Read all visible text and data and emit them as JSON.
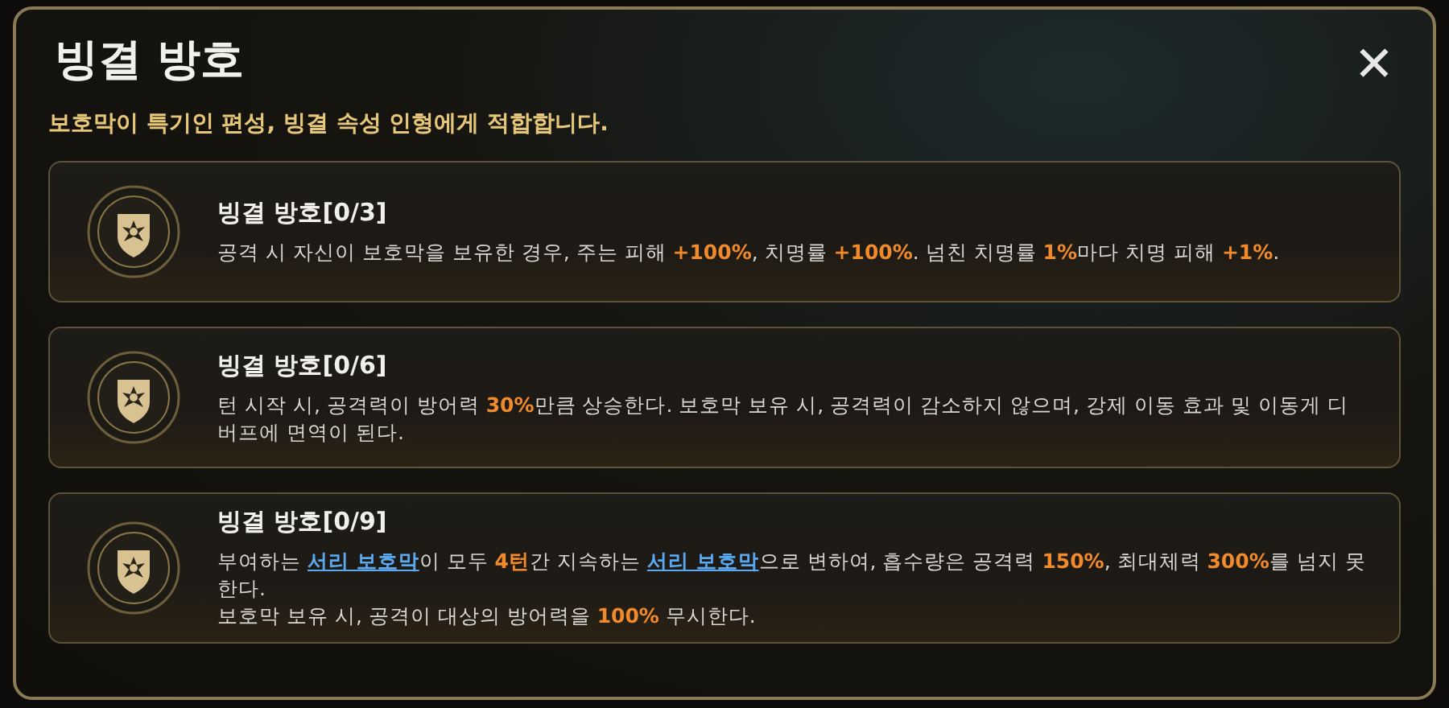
{
  "title": "빙결 방호",
  "subtitle": "보호막이 특기인 편성, 빙결 속성 인형에게 적합합니다.",
  "close": "✕",
  "effects": [
    {
      "name": "빙결 방호[0/3]",
      "paragraphs": [
        [
          {
            "kind": "plain",
            "text": "공격 시 자신이 보호막을 보유한 경우, 주는 피해 "
          },
          {
            "kind": "highlight",
            "text": "+100%"
          },
          {
            "kind": "plain",
            "text": ", 치명률 "
          },
          {
            "kind": "highlight",
            "text": "+100%"
          },
          {
            "kind": "plain",
            "text": ". 넘친 치명률 "
          },
          {
            "kind": "highlight",
            "text": "1%"
          },
          {
            "kind": "plain",
            "text": "마다 치명 피해 "
          },
          {
            "kind": "highlight",
            "text": "+1%"
          },
          {
            "kind": "plain",
            "text": "."
          }
        ]
      ]
    },
    {
      "name": "빙결 방호[0/6]",
      "paragraphs": [
        [
          {
            "kind": "plain",
            "text": "턴 시작 시, 공격력이 방어력 "
          },
          {
            "kind": "highlight",
            "text": "30%"
          },
          {
            "kind": "plain",
            "text": "만큼 상승한다. 보호막 보유 시, 공격력이 감소하지 않으며, 강제 이동 효과 및 이동게 디버프에 면역이 된다."
          }
        ]
      ]
    },
    {
      "name": "빙결 방호[0/9]",
      "paragraphs": [
        [
          {
            "kind": "plain",
            "text": "부여하는 "
          },
          {
            "kind": "link",
            "text": "서리 보호막"
          },
          {
            "kind": "plain",
            "text": "이 모두 "
          },
          {
            "kind": "highlight",
            "text": "4턴"
          },
          {
            "kind": "plain",
            "text": "간 지속하는 "
          },
          {
            "kind": "link",
            "text": "서리 보호막"
          },
          {
            "kind": "plain",
            "text": "으로 변하여, 흡수량은 공격력 "
          },
          {
            "kind": "highlight",
            "text": "150%"
          },
          {
            "kind": "plain",
            "text": ", 최대체력 "
          },
          {
            "kind": "highlight",
            "text": "300%"
          },
          {
            "kind": "plain",
            "text": "를 넘지 못한다."
          }
        ],
        [
          {
            "kind": "plain",
            "text": "보호막 보유 시, 공격이 대상의 방어력을 "
          },
          {
            "kind": "highlight",
            "text": "100%"
          },
          {
            "kind": "plain",
            "text": " 무시한다."
          }
        ]
      ]
    }
  ]
}
